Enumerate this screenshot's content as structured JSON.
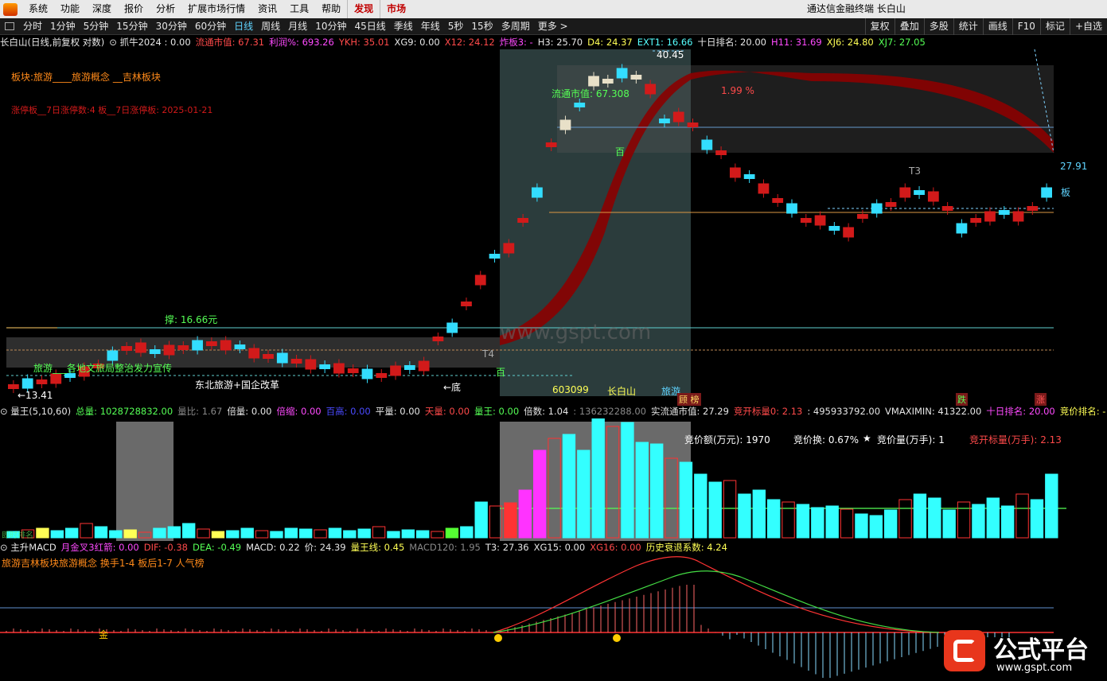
{
  "menubar": {
    "items": [
      "系统",
      "功能",
      "深度",
      "报价",
      "分析",
      "扩展市场行情",
      "资讯",
      "工具",
      "帮助"
    ],
    "red_items": [
      "发现",
      "市场"
    ],
    "title": "通达信金融终端  长白山"
  },
  "periodbar": {
    "items": [
      "分时",
      "1分钟",
      "5分钟",
      "15分钟",
      "30分钟",
      "60分钟",
      "日线",
      "周线",
      "月线",
      "10分钟",
      "45日线",
      "季线",
      "年线",
      "5秒",
      "15秒",
      "多周期",
      "更多 >"
    ],
    "active": "日线",
    "tools": [
      "复权",
      "叠加",
      "多股",
      "统计",
      "画线",
      "F10",
      "标记",
      "+自选"
    ]
  },
  "main_info": [
    {
      "t": "长白山(日线,前复权 对数)",
      "c": "#e6e6e6"
    },
    {
      "t": "⊙ 抓牛2024 : 0.00",
      "c": "#e6e6e6"
    },
    {
      "t": "流通市值: 67.31",
      "c": "#ff4a4a"
    },
    {
      "t": "利润%: 693.26",
      "c": "#ff4aff"
    },
    {
      "t": "YKH: 35.01",
      "c": "#ff4a4a"
    },
    {
      "t": "XG9: 0.00",
      "c": "#e6e6e6"
    },
    {
      "t": "X12: 24.12",
      "c": "#ff4a4a"
    },
    {
      "t": "炸板3: -",
      "c": "#ff4aff"
    },
    {
      "t": "H3: 25.70",
      "c": "#e6e6e6"
    },
    {
      "t": "D4: 24.37",
      "c": "#ffff55"
    },
    {
      "t": "EXT1: 16.66",
      "c": "#55ffff"
    },
    {
      "t": "十日排名: 20.00",
      "c": "#e6e6e6"
    },
    {
      "t": "H11: 31.69",
      "c": "#ff4aff"
    },
    {
      "t": "XJ6: 24.80",
      "c": "#ffff55"
    },
    {
      "t": "XJ7: 27.05",
      "c": "#55ff55"
    }
  ],
  "main_texts": {
    "sector": "板块:旅游____旅游概念 __吉林板块",
    "warn": "涨停板__7日涨停数:4 板__7日涨停板: 2025-01-21",
    "support": "撑: 16.66元",
    "market_val": "流通市值: 67.308",
    "theme1": "旅游___各地文旅局整治发力宣传",
    "theme2": "东北旅游+国企改革",
    "bottom": "←底",
    "low": "←13.41",
    "high": "40.45",
    "price_r": "27.91",
    "pct": "1.99 %",
    "code": "603099",
    "name": "长白山",
    "industry": "旅游",
    "watermark": "www.gspt.com",
    "hundred1": "百",
    "hundred2": "百",
    "t3": "T3",
    "t4": "T4",
    "board": "板",
    "tags": [
      {
        "t": "顾 榜",
        "c": "#ffdd66"
      },
      {
        "t": "跌",
        "c": "#55ff55"
      },
      {
        "t": "涨",
        "c": "#ff5555"
      }
    ]
  },
  "vol_info": [
    {
      "t": "⊙ 量王(5,10,60)",
      "c": "#e6e6e6"
    },
    {
      "t": "总量: 1028728832.00",
      "c": "#55ff55"
    },
    {
      "t": "量比: 1.67",
      "c": "#888888"
    },
    {
      "t": "倍量: 0.00",
      "c": "#e6e6e6"
    },
    {
      "t": "倍缩: 0.00",
      "c": "#ff4aff"
    },
    {
      "t": "百高: 0.00",
      "c": "#4a4aff"
    },
    {
      "t": "平量: 0.00",
      "c": "#e6e6e6"
    },
    {
      "t": "天量: 0.00",
      "c": "#ff4a4a"
    },
    {
      "t": "量王: 0.00",
      "c": "#55ff55"
    },
    {
      "t": "倍数: 1.04",
      "c": "#e6e6e6"
    },
    {
      "t": ": 136232288.00",
      "c": "#888888"
    },
    {
      "t": "实流通市值: 27.29",
      "c": "#e6e6e6"
    },
    {
      "t": "竞开标量0: 2.13",
      "c": "#ff4a4a"
    },
    {
      "t": ": 495933792.00",
      "c": "#e6e6e6"
    },
    {
      "t": "VMAXIMIN: 41322.00",
      "c": "#e6e6e6"
    },
    {
      "t": "十日排名: 20.00",
      "c": "#ff4aff"
    },
    {
      "t": "竞价排名: -",
      "c": "#ffff55"
    }
  ],
  "vol_texts": {
    "amount": "竞价额(万元): 1970",
    "turnover": "竞价换: 0.67%",
    "star": "★",
    "volume": "竞价量(万手):   1",
    "openvol": "竞开标量(万手):  2.13",
    "left_tag": "即时排名"
  },
  "macd_info": [
    {
      "t": "⊙ 主升MACD",
      "c": "#e6e6e6"
    },
    {
      "t": "月金叉3红箭: 0.00",
      "c": "#ff4aff"
    },
    {
      "t": "DIF: -0.38",
      "c": "#ff4a4a"
    },
    {
      "t": "DEA: -0.49",
      "c": "#55ff55"
    },
    {
      "t": "MACD: 0.22",
      "c": "#e6e6e6"
    },
    {
      "t": "价: 24.39",
      "c": "#e6e6e6"
    },
    {
      "t": "量王线: 0.45",
      "c": "#ffff55"
    },
    {
      "t": "MACD120: 1.95",
      "c": "#888888"
    },
    {
      "t": "T3: 27.36",
      "c": "#e6e6e6"
    },
    {
      "t": "XG15: 0.00",
      "c": "#e6e6e6"
    },
    {
      "t": "XG16: 0.00",
      "c": "#ff4a4a"
    },
    {
      "t": "历史衰退系数: 4.24",
      "c": "#ffff55"
    }
  ],
  "macd_texts": {
    "desc": "旅游吉林板块旅游概念 换手1-4 板后1-7 人气榜",
    "gold": "金"
  },
  "brand": {
    "name": "公式平台",
    "url": "www.gspt.com"
  },
  "colors": {
    "up": "#ff2020",
    "down": "#33ddff",
    "bg": "#000000",
    "ribbon": "#8b0000"
  }
}
